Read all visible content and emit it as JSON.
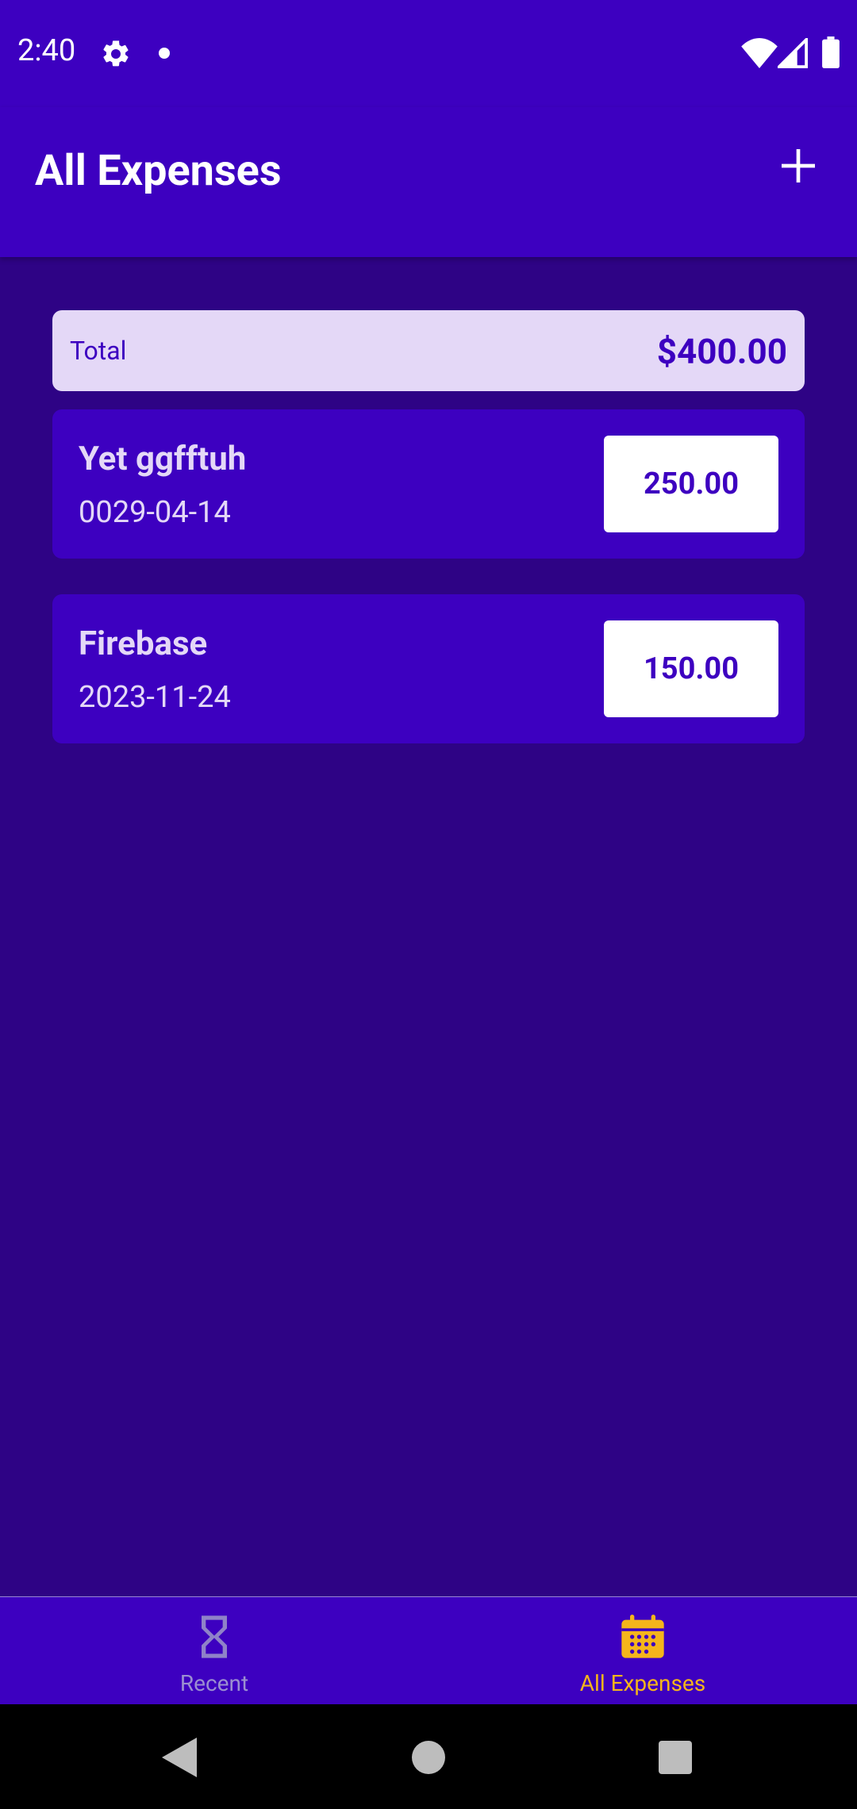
{
  "status_bar": {
    "time": "2:40",
    "icons": [
      "gear-icon",
      "notification-dot-icon",
      "wifi-icon",
      "signal-icon",
      "battery-icon"
    ]
  },
  "app_bar": {
    "title": "All Expenses",
    "add_icon": "plus-icon"
  },
  "summary": {
    "label": "Total",
    "value": "$400.00"
  },
  "expenses": [
    {
      "title": "Yet ggfftuh",
      "date": "0029-04-14",
      "amount": "250.00"
    },
    {
      "title": "Firebase",
      "date": "2023-11-24",
      "amount": "150.00"
    }
  ],
  "bottom_nav": {
    "items": [
      {
        "label": "Recent",
        "icon": "hourglass-icon",
        "active": false
      },
      {
        "label": "All Expenses",
        "icon": "calendar-icon",
        "active": true
      }
    ]
  },
  "colors": {
    "primary": "#3d00c0",
    "background": "#2e0385",
    "accent": "#f5b51b",
    "summary_bg": "#e4d8f7"
  }
}
